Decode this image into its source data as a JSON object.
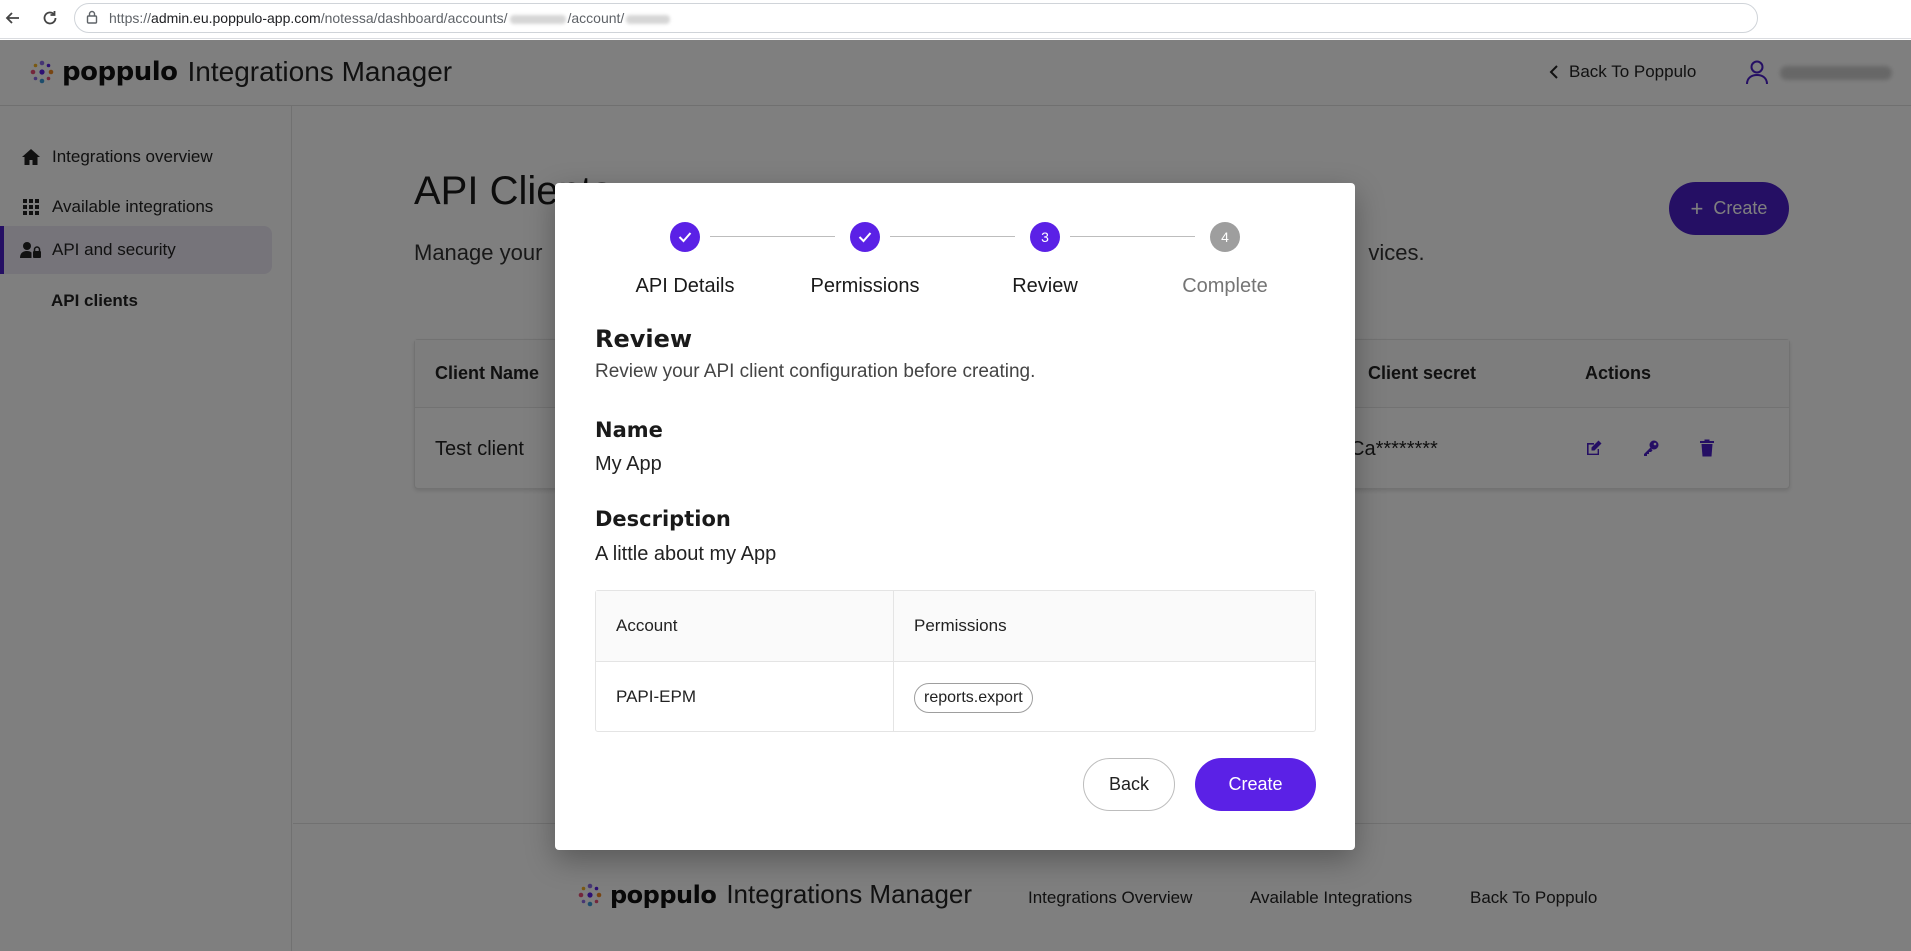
{
  "browser": {
    "url_prefix": "https://",
    "url_host": "admin.eu.poppulo-app.com",
    "url_path_1": "/notessa/dashboard/accounts/",
    "url_path_2": "/account/",
    "icons": [
      "back-arrow-icon",
      "reload-icon",
      "site-info-icon"
    ]
  },
  "header": {
    "brand_word": "poppulo",
    "product": "Integrations Manager",
    "back_link": "Back To Poppulo"
  },
  "sidebar": {
    "items": [
      {
        "label": "Integrations overview",
        "icon": "home-icon"
      },
      {
        "label": "Available integrations",
        "icon": "grid-icon"
      },
      {
        "label": "API and security",
        "icon": "user-lock-icon"
      }
    ],
    "sub_item": "API clients"
  },
  "page": {
    "title": "API Clients",
    "desc_start": "Manage your",
    "desc_end": "vices.",
    "create_label": "Create"
  },
  "clients_table": {
    "headers": [
      "Client Name",
      "Client secret",
      "Actions"
    ],
    "row": {
      "name": "Test client",
      "secret": "Ca********"
    }
  },
  "footer": {
    "links": [
      "Integrations Overview",
      "Available Integrations",
      "Back To Poppulo"
    ]
  },
  "modal": {
    "steps": [
      {
        "number": "1",
        "label": "API Details",
        "state": "done"
      },
      {
        "number": "2",
        "label": "Permissions",
        "state": "done"
      },
      {
        "number": "3",
        "label": "Review",
        "state": "current"
      },
      {
        "number": "4",
        "label": "Complete",
        "state": "todo"
      }
    ],
    "heading": "Review",
    "subheading": "Review your API client configuration before creating.",
    "name_label": "Name",
    "name_value": "My App",
    "desc_label": "Description",
    "desc_value": "A little about my App",
    "table": {
      "headers": [
        "Account",
        "Permissions"
      ],
      "rows": [
        {
          "account": "PAPI-EPM",
          "permission": "reports.export"
        }
      ]
    },
    "back_label": "Back",
    "create_label": "Create"
  },
  "colors": {
    "accent": "#5b21e6",
    "accent_dark": "#4b1fc9",
    "overlay": "rgba(0,0,0,0.5)"
  }
}
